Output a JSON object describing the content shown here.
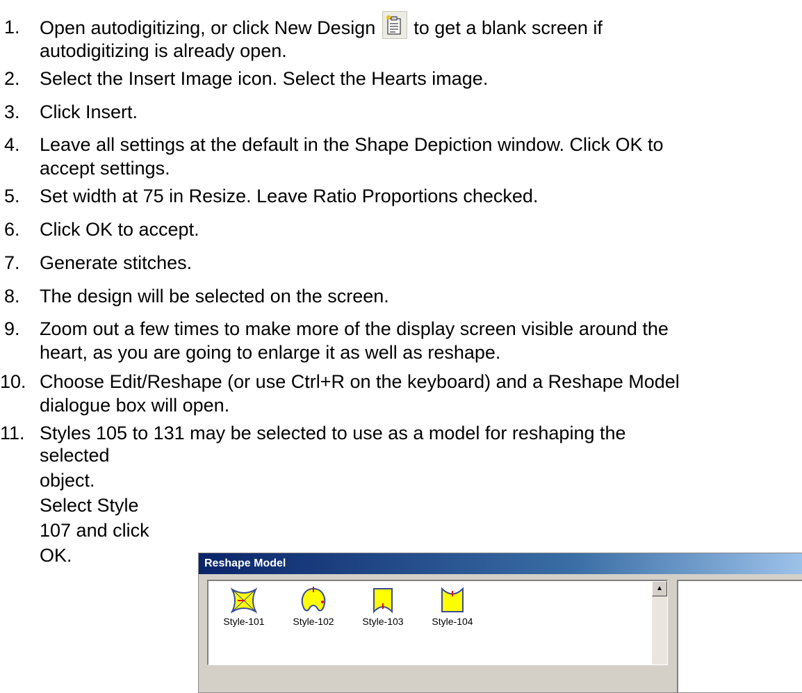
{
  "steps": [
    {
      "num": "1.",
      "lines": [
        "Open autodigitizing, or click New Design",
        "to get a blank screen if",
        "autodigitizing is already open."
      ]
    },
    {
      "num": "2.",
      "lines": [
        "Select the Insert Image icon.  Select the Hearts image."
      ]
    },
    {
      "num": "3.",
      "lines": [
        "Click Insert."
      ]
    },
    {
      "num": "4.",
      "lines": [
        "Leave all settings at the default in the Shape Depiction window.  Click OK to",
        "accept settings."
      ]
    },
    {
      "num": "5.",
      "lines": [
        "Set width at 75 in Resize.  Leave Ratio Proportions checked."
      ]
    },
    {
      "num": "6.",
      "lines": [
        "Click OK to accept."
      ]
    },
    {
      "num": "7.",
      "lines": [
        "Generate stitches."
      ]
    },
    {
      "num": "8.",
      "lines": [
        "The design will be selected on the screen."
      ]
    },
    {
      "num": "9.",
      "lines": [
        "Zoom out a few times to make more of the display screen visible around the",
        "heart, as you are going to enlarge it as well as reshape."
      ]
    },
    {
      "num": "10.",
      "lines": [
        "Choose Edit/Reshape (or use Ctrl+R on the keyboard) and a Reshape Model",
        "dialogue box will open."
      ]
    },
    {
      "num": "11.",
      "lines": [
        "Styles 105 to 131 may be selected to use as a model for reshaping the",
        "selected",
        "object.",
        "Select Style",
        "107 and click",
        "OK."
      ]
    }
  ],
  "icon": {
    "name": "new-design-icon"
  },
  "dialog": {
    "title": "Reshape Model",
    "styles": [
      "Style-101",
      "Style-102",
      "Style-103",
      "Style-104"
    ],
    "scroll_up_glyph": "▲"
  },
  "colors": {
    "style_fill": "#ffff00",
    "title_start": "#0a246a",
    "title_end": "#a6caf0"
  }
}
